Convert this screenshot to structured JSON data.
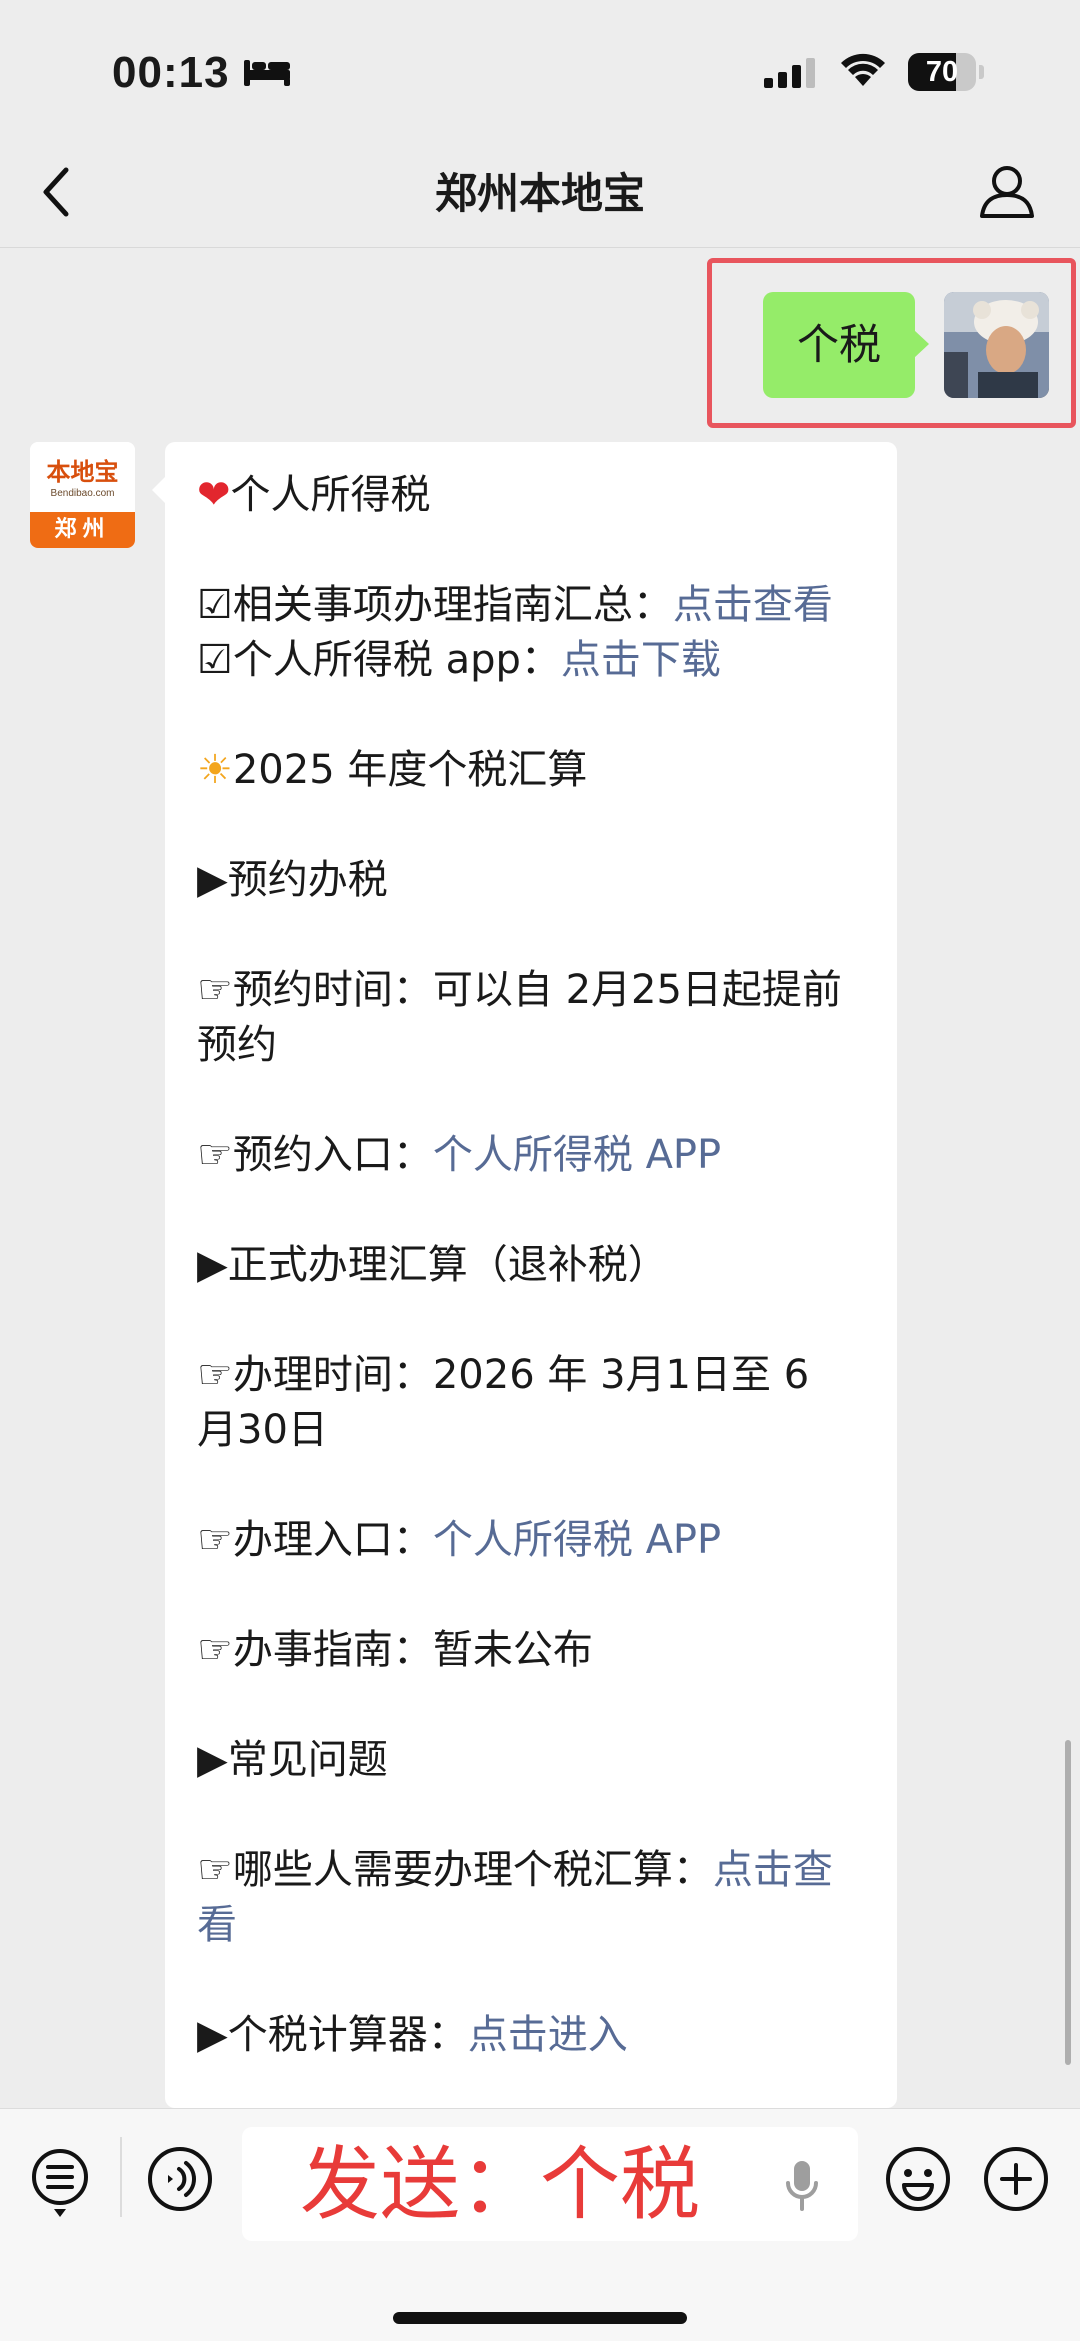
{
  "status_bar": {
    "time": "00:13",
    "battery": "70",
    "battery_level": 0.7
  },
  "nav": {
    "title": "郑州本地宝",
    "back_icon": "chevron-left-icon",
    "profile_icon": "person-icon"
  },
  "chat": {
    "sent_message": "个税",
    "bot_avatar": {
      "brand": "本地宝",
      "site": "Bendibao.com",
      "city": "郑州"
    },
    "reply": {
      "heading": "个人所得税",
      "guide_label": "相关事项办理指南汇总：",
      "guide_link": "点击查看",
      "app_label": "个人所得税 app：",
      "app_link": "点击下载",
      "section_title": "2025 年度个税汇算",
      "appointment_title": "▶预约办税",
      "appointment_time": "☞预约时间：可以自 2月25日起提前预约",
      "appointment_entry_label": "☞预约入口：",
      "appointment_entry_link": "个人所得税 APP",
      "formal_title": "▶正式办理汇算（退补税）",
      "formal_time": "☞办理时间：2026 年 3月1日至 6 月30日",
      "formal_entry_label": "☞办理入口：",
      "formal_entry_link": "个人所得税 APP",
      "guide_status": "☞办事指南：暂未公布",
      "faq_title": "▶常见问题",
      "faq_q_label": "☞哪些人需要办理个税汇算：",
      "faq_q_link": "点击查看",
      "calc_label": "▶个税计算器：",
      "calc_link": "点击进入"
    }
  },
  "input_bar": {
    "value": "发送：个税"
  },
  "colors": {
    "link": "#576b95",
    "sent_bubble": "#95ec69",
    "highlight": "#e8555d",
    "input_text": "#e83b39"
  }
}
